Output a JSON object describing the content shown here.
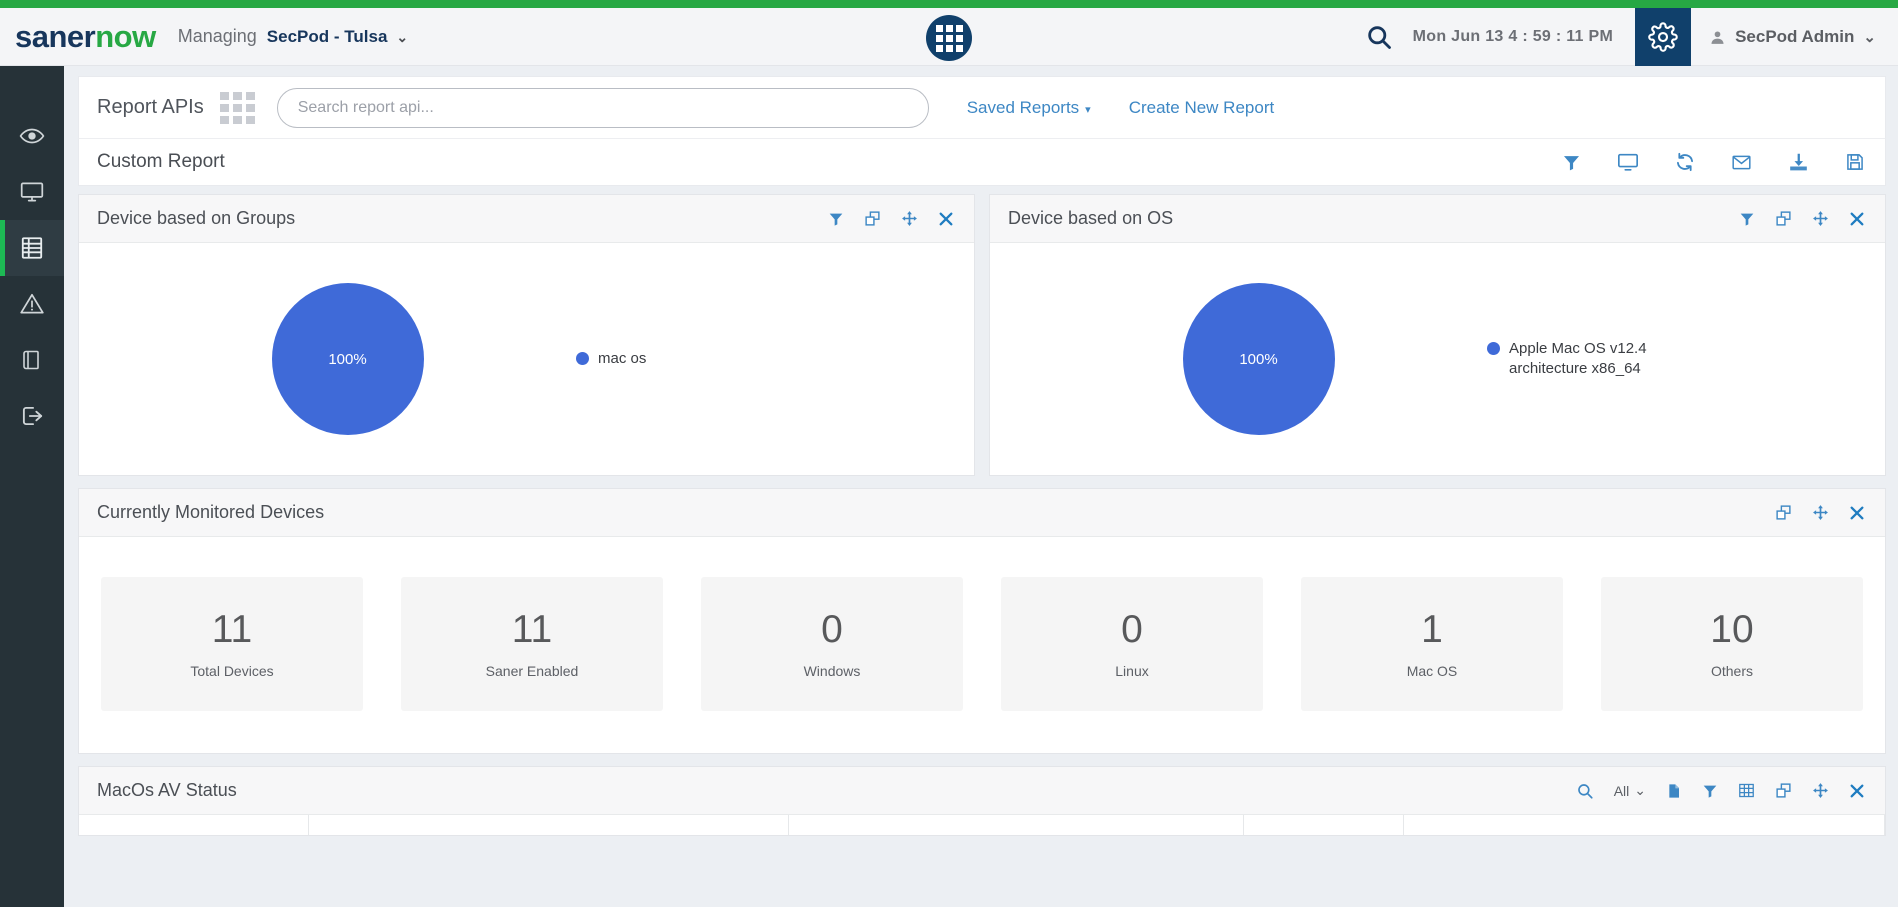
{
  "header": {
    "logo_saner": "saner",
    "logo_now": "now",
    "managing_label": "Managing",
    "tenant": "SecPod - Tulsa",
    "tenant_caret": "⌄",
    "datetime": "Mon Jun 13  4 : 59 : 11 PM",
    "user_name": "SecPod Admin",
    "user_caret": "⌄",
    "icons": {
      "apps_grid": "apps-grid-icon",
      "search": "search-icon",
      "settings": "gear-icon",
      "avatar": "user-avatar-icon"
    }
  },
  "sidebar": {
    "items": [
      {
        "name": "visibility",
        "icon": "eye-icon",
        "active": false
      },
      {
        "name": "devices",
        "icon": "monitor-icon",
        "active": false
      },
      {
        "name": "reports",
        "icon": "report-icon",
        "active": true
      },
      {
        "name": "alerts",
        "icon": "warning-triangle-icon",
        "active": false
      },
      {
        "name": "knowledge",
        "icon": "book-icon",
        "active": false
      },
      {
        "name": "logout",
        "icon": "logout-icon",
        "active": false
      }
    ]
  },
  "api_bar": {
    "title": "Report APIs",
    "grid_icon": "grid-view-icon",
    "search_placeholder": "Search report api...",
    "search_value": "",
    "saved_reports": "Saved Reports",
    "saved_reports_caret": "▾",
    "create_new_report": "Create New Report"
  },
  "report": {
    "title": "Custom Report",
    "actions": [
      {
        "name": "filter-icon",
        "label": "Filter"
      },
      {
        "name": "display-icon",
        "label": "Display"
      },
      {
        "name": "refresh-icon",
        "label": "Refresh"
      },
      {
        "name": "mail-icon",
        "label": "Email"
      },
      {
        "name": "download-icon",
        "label": "Download"
      },
      {
        "name": "save-icon",
        "label": "Save"
      }
    ]
  },
  "panels": {
    "device_groups": {
      "title": "Device based on Groups",
      "icons": [
        "filter-icon",
        "duplicate-icon",
        "move-icon",
        "close-icon"
      ]
    },
    "device_os": {
      "title": "Device based on OS",
      "icons": [
        "filter-icon",
        "duplicate-icon",
        "move-icon",
        "close-icon"
      ]
    },
    "monitored": {
      "title": "Currently Monitored Devices",
      "icons": [
        "duplicate-icon",
        "move-icon",
        "close-icon"
      ],
      "cards": [
        {
          "value": "11",
          "label": "Total Devices"
        },
        {
          "value": "11",
          "label": "Saner Enabled"
        },
        {
          "value": "0",
          "label": "Windows"
        },
        {
          "value": "0",
          "label": "Linux"
        },
        {
          "value": "1",
          "label": "Mac OS"
        },
        {
          "value": "10",
          "label": "Others"
        }
      ]
    },
    "av_status": {
      "title": "MacOs AV Status",
      "search_icon": "search-icon",
      "filter_select_value": "All",
      "filter_select_caret": "⌄",
      "icons": [
        "document-icon",
        "filter-icon",
        "table-icon",
        "duplicate-icon",
        "move-icon",
        "close-icon"
      ]
    }
  },
  "chart_data": [
    {
      "type": "pie",
      "title": "Device based on Groups",
      "categories": [
        "mac os"
      ],
      "values": [
        100
      ],
      "labels": [
        "100%"
      ],
      "colors": [
        "#3f6ad8"
      ],
      "legend_position": "right",
      "legend": [
        "mac os"
      ]
    },
    {
      "type": "pie",
      "title": "Device based on OS",
      "categories": [
        "Apple Mac OS v12.4 architecture x86_64"
      ],
      "values": [
        100
      ],
      "labels": [
        "100%"
      ],
      "colors": [
        "#3f6ad8"
      ],
      "legend_position": "right",
      "legend": [
        "Apple Mac OS v12.4",
        "architecture x86_64"
      ]
    }
  ],
  "colors": {
    "brand_green": "#27a844",
    "brand_navy": "#17365c",
    "accent_blue": "#3d87c4",
    "chart_blue": "#3f6ad8",
    "sidebar_bg": "#263238"
  }
}
